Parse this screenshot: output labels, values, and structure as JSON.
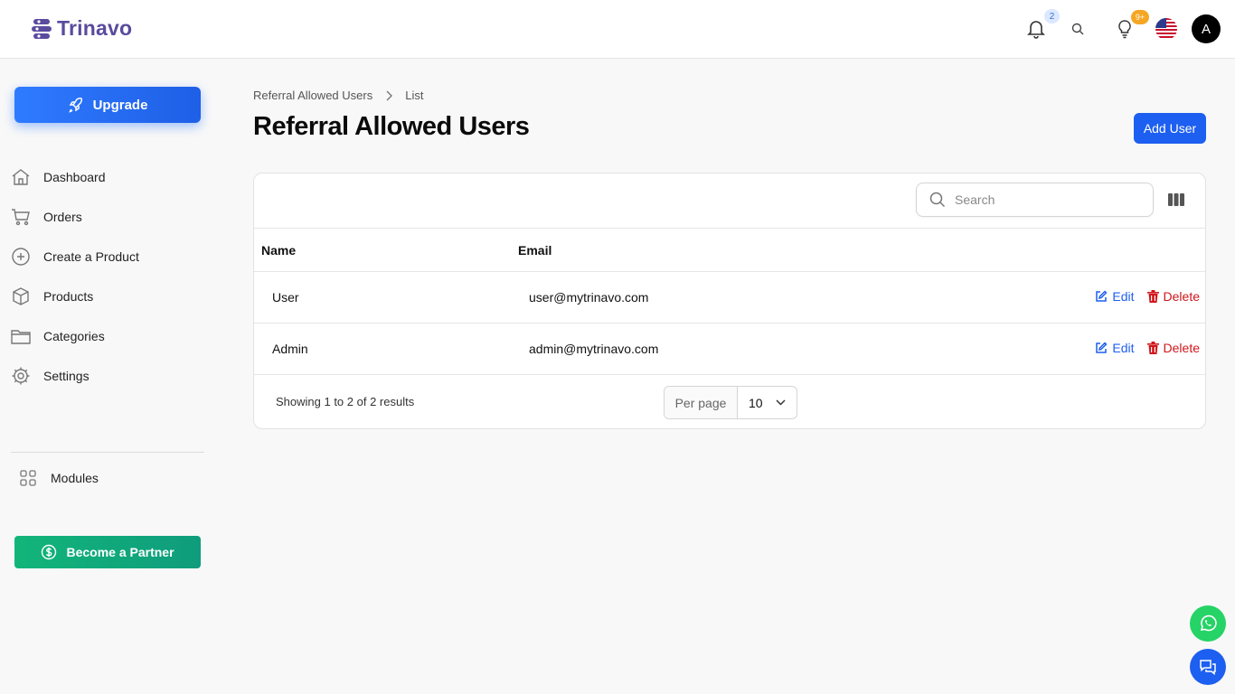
{
  "brand": {
    "name": "Trinavo",
    "logo_color": "#5a4b9e"
  },
  "header": {
    "notifications_count": "2",
    "tips_count": "9+",
    "avatar_letter": "A",
    "icons": [
      "bell-icon",
      "search-icon",
      "lightbulb-icon",
      "us-flag-icon"
    ]
  },
  "sidebar": {
    "upgrade_label": "Upgrade",
    "items": [
      {
        "label": "Dashboard",
        "icon": "home-icon"
      },
      {
        "label": "Orders",
        "icon": "cart-icon"
      },
      {
        "label": "Create a Product",
        "icon": "plus-circle-icon"
      },
      {
        "label": "Products",
        "icon": "box-icon"
      },
      {
        "label": "Categories",
        "icon": "folder-icon"
      },
      {
        "label": "Settings",
        "icon": "gear-icon"
      }
    ],
    "modules_label": "Modules",
    "partner_label": "Become a Partner"
  },
  "breadcrumb": {
    "parent": "Referral Allowed Users",
    "current": "List"
  },
  "page": {
    "title": "Referral Allowed Users",
    "add_button": "Add User"
  },
  "table": {
    "search_placeholder": "Search",
    "columns": [
      "Name",
      "Email"
    ],
    "rows": [
      {
        "name": "User",
        "email": "user@mytrinavo.com"
      },
      {
        "name": "Admin",
        "email": "admin@mytrinavo.com"
      }
    ],
    "edit_label": "Edit",
    "delete_label": "Delete",
    "summary": "Showing 1 to 2 of 2 results",
    "per_page_label": "Per page",
    "per_page_value": "10"
  },
  "colors": {
    "primary": "#1d5ff0",
    "danger": "#d0161b",
    "success": "#12b57a",
    "whatsapp": "#25d366"
  }
}
